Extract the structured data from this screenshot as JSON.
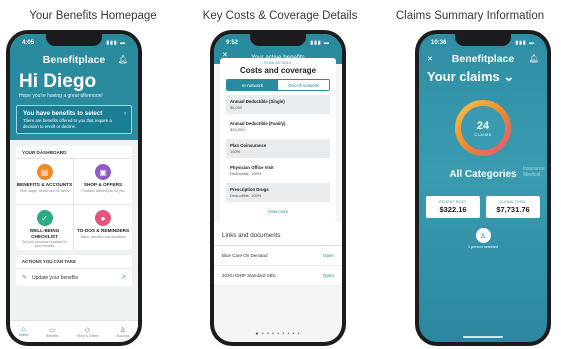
{
  "captions": [
    "Your Benefits Homepage",
    "Key Costs & Coverage Details",
    "Claims Summary Information"
  ],
  "colors": {
    "teal": "#2a8a9e",
    "orange": "#ef8a2b",
    "purple": "#8e5cc4",
    "green": "#2cab88",
    "rose": "#e0567a"
  },
  "phone1": {
    "time": "4:05",
    "brand": "Benefitplace",
    "greeting": "Hi Diego",
    "subgreeting": "Hope you're having a great afternoon!",
    "notice_title": "You have benefits to select",
    "notice_body": "There are benefits offered to you that require a decision to enroll or decline.",
    "dashboard_title": "YOUR DASHBOARD",
    "tiles": [
      {
        "label": "BENEFITS & ACCOUNTS",
        "desc": "Plan usage, details and ID cards",
        "icon": "briefcase-icon"
      },
      {
        "label": "SHOP & OFFERS",
        "desc": "Products tailored just for you",
        "icon": "cart-icon"
      },
      {
        "label": "WELL-BEING CHECKLIST",
        "desc": "Set your personal checklist for your benefits",
        "icon": "checklist-icon"
      },
      {
        "label": "TO-DOS & REMINDERS",
        "desc": "Tasks, activities and deadlines",
        "icon": "bell-icon"
      }
    ],
    "actions_title": "ACTIONS YOU CAN TAKE",
    "action_item": "Update your benefits",
    "tabs": [
      "Home",
      "Benefits",
      "Shop & Offers",
      "Account"
    ]
  },
  "phone2": {
    "time": "9:52",
    "nav_title": "Your active benefits",
    "kicker": "PLAN DETAILS",
    "title": "Costs and coverage",
    "seg": [
      "In-network",
      "Out-of-network"
    ],
    "costs": [
      {
        "label": "Annual Deductible (Single)",
        "value": "$5,000"
      },
      {
        "label": "Annual Deductible (Family)",
        "value": "$10,000"
      },
      {
        "label": "Plan Coinsurance",
        "value": "100%"
      },
      {
        "label": "Physician Office Visit",
        "value": "Deductible, 100%"
      },
      {
        "label": "Prescription Drugs",
        "value": "Deductible, 100%"
      }
    ],
    "view_more": "View more",
    "links_title": "Links and documents",
    "links": [
      {
        "label": "Blue Care On Demand",
        "action": "Open"
      },
      {
        "label": "2020 HDHP Standard SBC",
        "action": "Open"
      }
    ]
  },
  "phone3": {
    "time": "10:36",
    "brand": "Benefitplace",
    "title": "Your claims",
    "count": "24",
    "count_label": "CLAIMS",
    "category": "All Categories",
    "category_next": "Insurance Medical",
    "totals": [
      {
        "label": "PATIENT RESP.",
        "value": "$322.16"
      },
      {
        "label": "CLAIMS TOTAL",
        "value": "$7,731.76"
      }
    ],
    "person_selected": "1 person selected"
  }
}
